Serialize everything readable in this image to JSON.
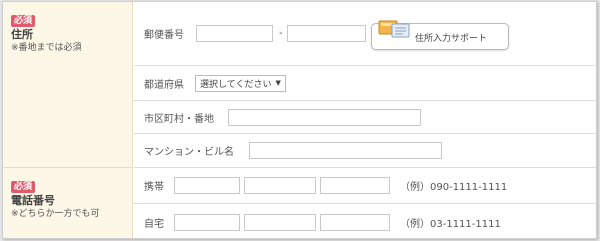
{
  "address_section": {
    "required_badge": "必須",
    "title": "住所",
    "note": "※番地までは必須",
    "postal": {
      "label": "郵便番号",
      "separator": "-",
      "support_button": "住所入力サポート"
    },
    "prefecture": {
      "label": "都道府県",
      "selected": "選択してください"
    },
    "city": {
      "label": "市区町村・番地"
    },
    "building": {
      "label": "マンション・ビル名"
    }
  },
  "phone_section": {
    "required_badge": "必須",
    "title": "電話番号",
    "note": "※どちらか一方でも可",
    "mobile": {
      "label": "携帯",
      "example": "（例）090-1111-1111"
    },
    "home": {
      "label": "自宅",
      "example": "（例）03-1111-1111"
    }
  },
  "colors": {
    "badge": "#e15a6b",
    "label_bg": "#fdf7e7"
  }
}
